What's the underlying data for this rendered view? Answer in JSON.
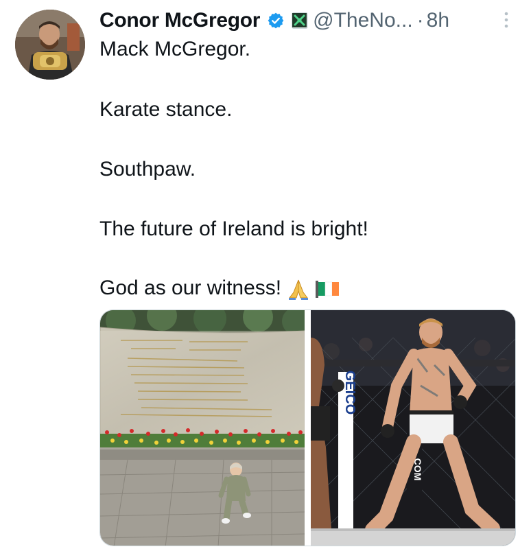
{
  "author": {
    "display_name": "Conor McGregor",
    "handle": "@TheNo...",
    "separator": "·",
    "time": "8h",
    "verified_icon": "verified-check-icon",
    "affiliate_icon": "affiliate-badge-icon"
  },
  "post": {
    "lines": [
      "Mack McGregor.",
      "Karate stance.",
      "Southpaw.",
      "The future of Ireland is bright!",
      "God as our witness!"
    ],
    "emojis": [
      "folded-hands-emoji",
      "ireland-flag-emoji"
    ]
  },
  "media": {
    "images": [
      {
        "name": "memorial-wall-toddler-photo"
      },
      {
        "name": "octagon-fighter-southpaw-photo",
        "ring_text": "GEICO",
        "banner_text": ".COM"
      }
    ]
  },
  "colors": {
    "text_primary": "#0f1419",
    "text_secondary": "#536471",
    "verified_blue": "#1d9bf0",
    "border": "#cfd9de"
  }
}
